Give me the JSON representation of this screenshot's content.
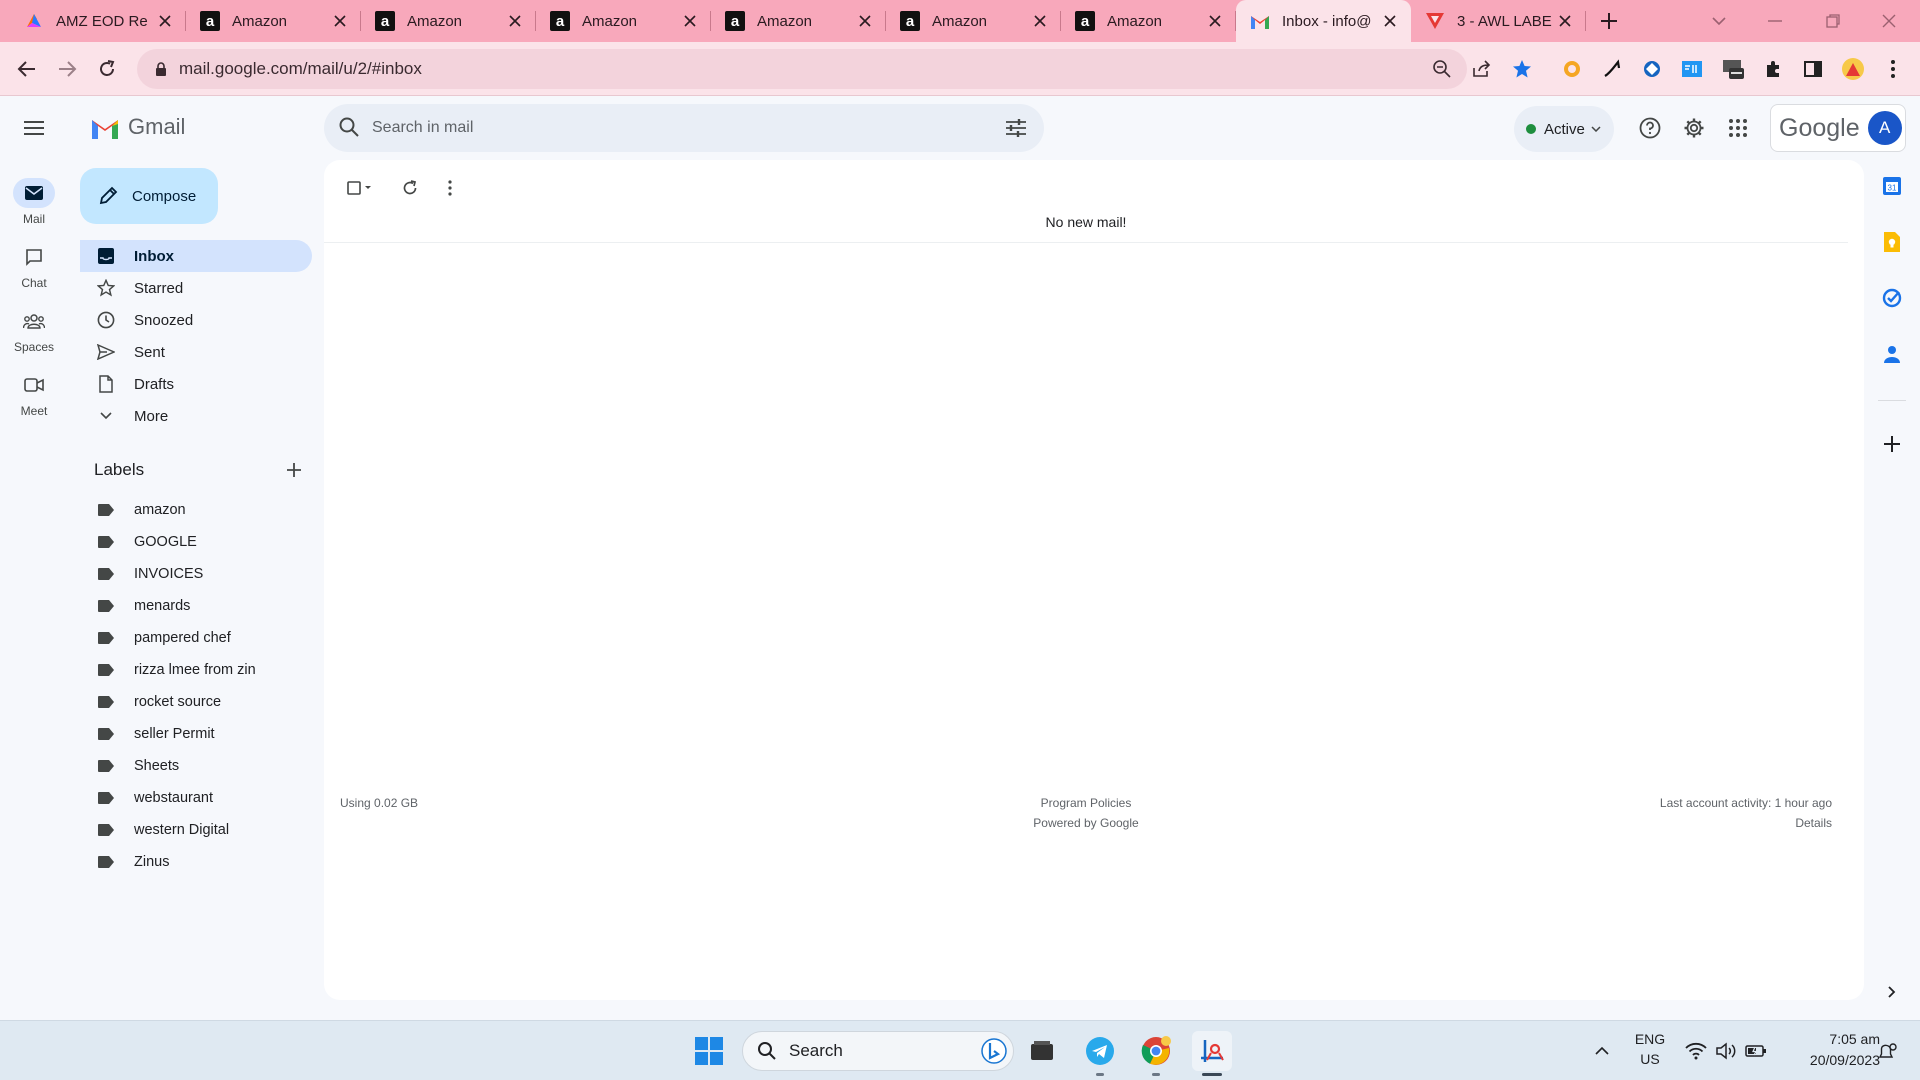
{
  "browser": {
    "tabs": [
      {
        "title": "AMZ EOD Re",
        "icon": "colorful-logo-icon",
        "active": false
      },
      {
        "title": "Amazon",
        "icon": "amazon-icon",
        "active": false
      },
      {
        "title": "Amazon",
        "icon": "amazon-icon",
        "active": false
      },
      {
        "title": "Amazon",
        "icon": "amazon-icon",
        "active": false
      },
      {
        "title": "Amazon",
        "icon": "amazon-icon",
        "active": false
      },
      {
        "title": "Amazon",
        "icon": "amazon-icon",
        "active": false
      },
      {
        "title": "Amazon",
        "icon": "amazon-icon",
        "active": false
      },
      {
        "title": "Inbox - info@",
        "icon": "gmail-icon",
        "active": true
      },
      {
        "title": "3 - AWL LABE",
        "icon": "red-logo-icon",
        "active": false
      }
    ],
    "url": "mail.google.com/mail/u/2/#inbox",
    "theme_color": "#f8a8bb",
    "toolbar_color": "#fbe3e9"
  },
  "gmail": {
    "app_name": "Gmail",
    "search_placeholder": "Search in mail",
    "status": "Active",
    "google_wordmark": "Google",
    "avatar_letter": "A",
    "rail": [
      {
        "label": "Mail",
        "icon": "mail-icon",
        "active": true
      },
      {
        "label": "Chat",
        "icon": "chat-icon",
        "active": false
      },
      {
        "label": "Spaces",
        "icon": "spaces-icon",
        "active": false
      },
      {
        "label": "Meet",
        "icon": "meet-icon",
        "active": false
      }
    ],
    "compose_label": "Compose",
    "nav": [
      {
        "label": "Inbox",
        "icon": "inbox-icon",
        "active": true
      },
      {
        "label": "Starred",
        "icon": "star-icon",
        "active": false
      },
      {
        "label": "Snoozed",
        "icon": "clock-icon",
        "active": false
      },
      {
        "label": "Sent",
        "icon": "send-icon",
        "active": false
      },
      {
        "label": "Drafts",
        "icon": "draft-icon",
        "active": false
      },
      {
        "label": "More",
        "icon": "chevron-down-icon",
        "active": false
      }
    ],
    "labels_heading": "Labels",
    "labels": [
      "amazon",
      "GOOGLE",
      "INVOICES",
      "menards",
      "pampered chef",
      "rizza lmee from zin",
      "rocket source",
      "seller Permit",
      "Sheets",
      "webstaurant",
      "western Digital",
      "Zinus"
    ],
    "empty_message": "No new mail!",
    "footer": {
      "storage": "Using 0.02 GB",
      "policies": "Program Policies",
      "powered": "Powered by Google",
      "activity": "Last account activity: 1 hour ago",
      "details": "Details"
    },
    "accent_color": "#d3e3fd",
    "compose_color": "#c2e7ff"
  },
  "taskbar": {
    "search_label": "Search",
    "language": "ENG",
    "region": "US",
    "time": "7:05 am",
    "date": "20/09/2023"
  }
}
